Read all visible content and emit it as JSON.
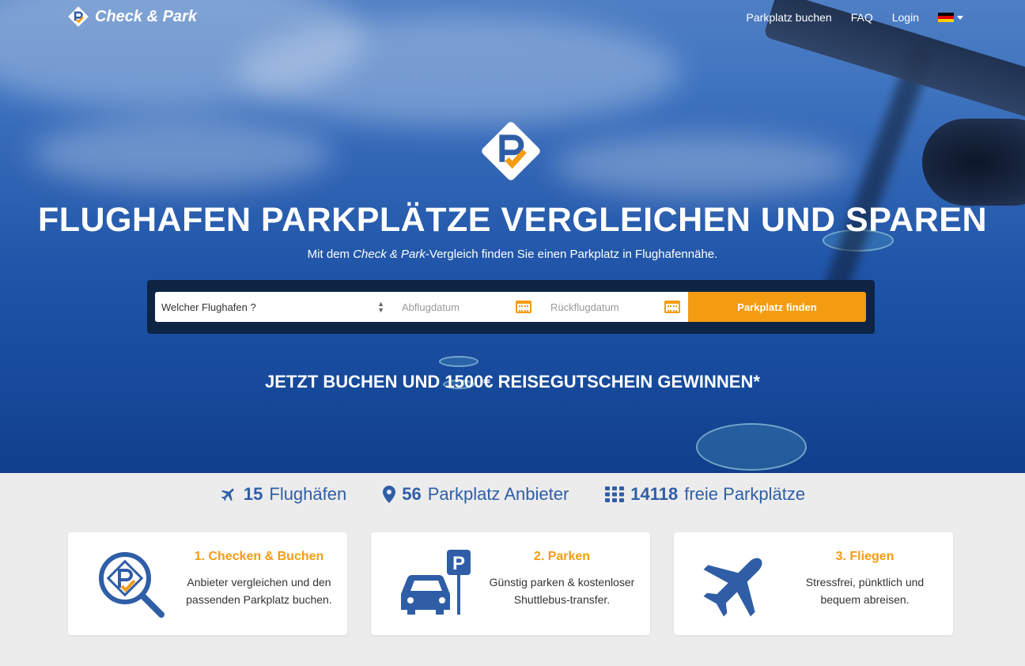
{
  "nav": {
    "brand": "Check & Park",
    "links": [
      "Parkplatz buchen",
      "FAQ",
      "Login"
    ],
    "language": "Deutsch"
  },
  "hero": {
    "headline": "FLUGHAFEN PARKPLÄTZE VERGLEICHEN UND SPAREN",
    "subline_prefix": "Mit dem ",
    "subline_brand": "Check & Park",
    "subline_suffix": "-Vergleich finden Sie einen Parkplatz in Flughafennähe.",
    "promo": "JETZT BUCHEN UND 1500€ REISEGUTSCHEIN GEWINNEN*"
  },
  "search": {
    "airport_value": "Welcher Flughafen ?",
    "departure_placeholder": "Abflugdatum",
    "return_placeholder": "Rückflugdatum",
    "submit_label": "Parkplatz finden"
  },
  "stats": [
    {
      "value": "15",
      "label": "Flughäfen",
      "icon": "plane-icon"
    },
    {
      "value": "56",
      "label": "Parkplatz Anbieter",
      "icon": "map-marker-icon"
    },
    {
      "value": "14118",
      "label": "freie Parkplätze",
      "icon": "grid-icon"
    }
  ],
  "steps": [
    {
      "title": "1. Checken & Buchen",
      "text": "Anbieter vergleichen und den passenden Parkplatz buchen.",
      "icon": "search-logo-icon"
    },
    {
      "title": "2. Parken",
      "text": "Günstig parken & kostenloser Shuttlebus-transfer.",
      "icon": "car-parking-icon"
    },
    {
      "title": "3. Fliegen",
      "text": "Stressfrei, pünktlich und bequem abreisen.",
      "icon": "airplane-icon"
    }
  ],
  "colors": {
    "accent": "#f39c12",
    "brand_blue": "#2f5ea7",
    "search_bg": "#0d2444"
  }
}
